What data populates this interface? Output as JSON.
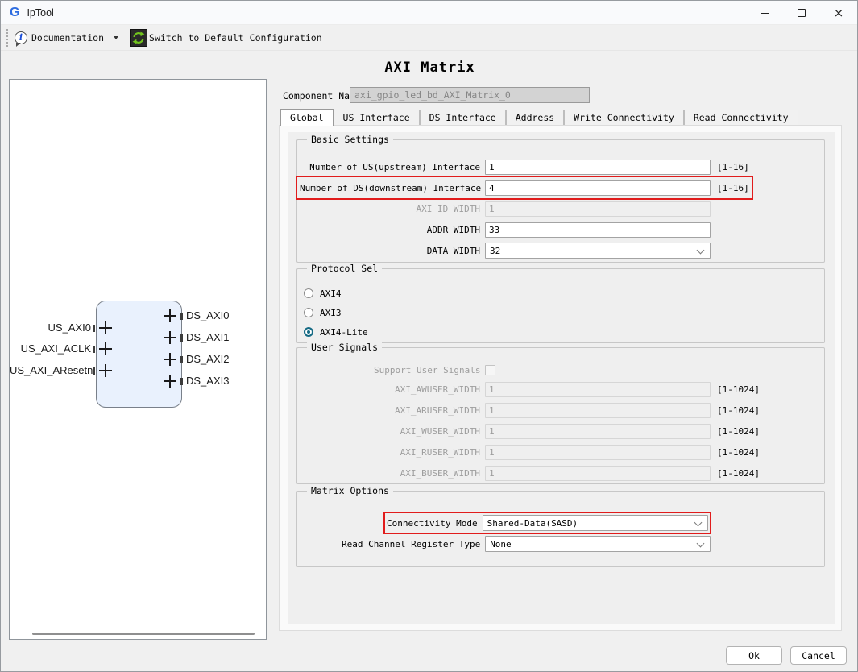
{
  "window": {
    "logo": "G",
    "title": "IpTool"
  },
  "toolbar": {
    "documentation": "Documentation",
    "switch_default": "Switch to Default Configuration"
  },
  "page": {
    "title": "AXI Matrix",
    "component_name_label": "Component Name",
    "component_name_value": "axi_gpio_led_bd_AXI_Matrix_0"
  },
  "tabs": [
    {
      "label": "Global",
      "active": true
    },
    {
      "label": "US Interface",
      "active": false
    },
    {
      "label": "DS Interface",
      "active": false
    },
    {
      "label": "Address",
      "active": false
    },
    {
      "label": "Write Connectivity",
      "active": false
    },
    {
      "label": "Read Connectivity",
      "active": false
    }
  ],
  "diagram": {
    "left_ports": [
      "US_AXI0",
      "US_AXI_ACLK",
      "US_AXI_AResetn"
    ],
    "right_ports": [
      "DS_AXI0",
      "DS_AXI1",
      "DS_AXI2",
      "DS_AXI3"
    ]
  },
  "basic_settings": {
    "title": "Basic Settings",
    "rows": [
      {
        "label": "Number of US(upstream) Interface",
        "value": "1",
        "range": "[1-16]"
      },
      {
        "label": "Number of DS(downstream) Interface",
        "value": "4",
        "range": "[1-16]"
      },
      {
        "label": "AXI ID WIDTH",
        "value": "1"
      },
      {
        "label": "ADDR WIDTH",
        "value": "33"
      },
      {
        "label": "DATA WIDTH",
        "value": "32"
      }
    ]
  },
  "protocol_sel": {
    "title": "Protocol Sel",
    "options": [
      {
        "label": "AXI4",
        "selected": false
      },
      {
        "label": "AXI3",
        "selected": false
      },
      {
        "label": "AXI4-Lite",
        "selected": true
      }
    ]
  },
  "user_signals": {
    "title": "User Signals",
    "support_label": "Support User Signals",
    "support_checked": false,
    "rows": [
      {
        "label": "AXI_AWUSER_WIDTH",
        "value": "1",
        "range": "[1-1024]"
      },
      {
        "label": "AXI_ARUSER_WIDTH",
        "value": "1",
        "range": "[1-1024]"
      },
      {
        "label": "AXI_WUSER_WIDTH",
        "value": "1",
        "range": "[1-1024]"
      },
      {
        "label": "AXI_RUSER_WIDTH",
        "value": "1",
        "range": "[1-1024]"
      },
      {
        "label": "AXI_BUSER_WIDTH",
        "value": "1",
        "range": "[1-1024]"
      }
    ]
  },
  "matrix_options": {
    "title": "Matrix Options",
    "rows": [
      {
        "label": "Connectivity Mode",
        "value": "Shared-Data(SASD)",
        "highlighted": true
      },
      {
        "label": "Read Channel Register Type",
        "value": "None",
        "highlighted": false
      }
    ]
  },
  "footer": {
    "ok": "Ok",
    "cancel": "Cancel"
  },
  "colors": {
    "highlight_red": "#e11c1c",
    "radio_selected": "#156a84",
    "block_fill": "#e9f1fd",
    "logo_blue": "#2d6ce0",
    "sync_green": "#72c41e"
  }
}
